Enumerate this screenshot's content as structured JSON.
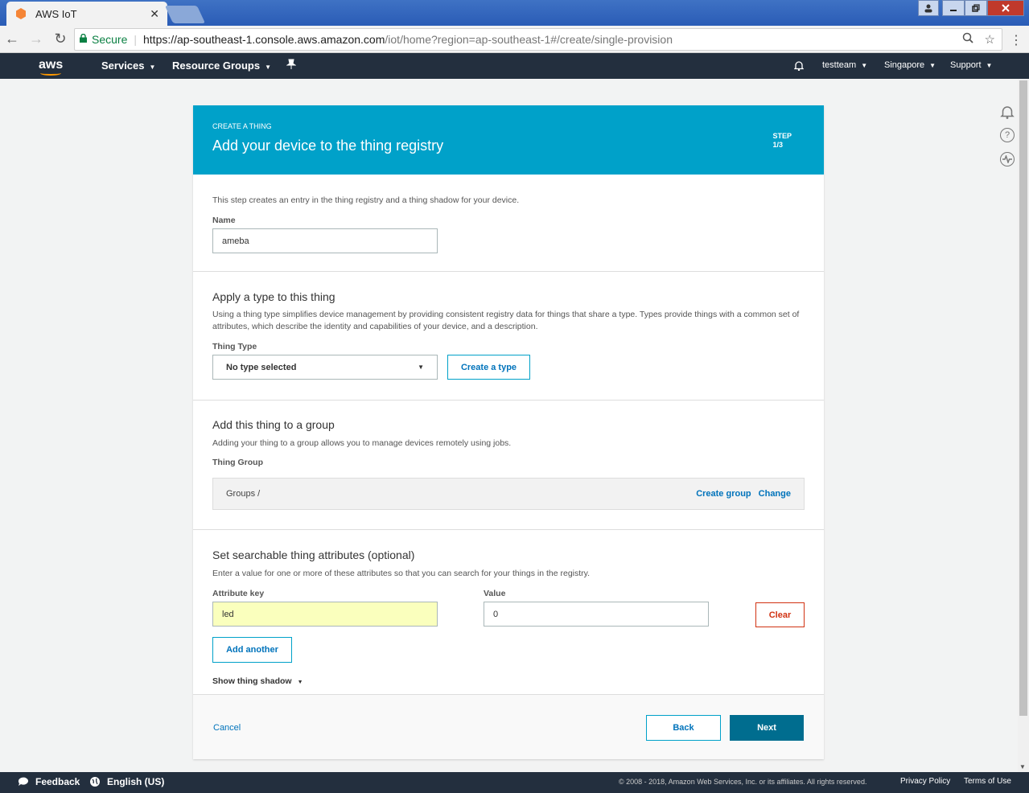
{
  "browser": {
    "tab_title": "AWS IoT",
    "tab_close": "✕",
    "secure_label": "Secure",
    "url_host": "https://ap-southeast-1.console.aws.amazon.com",
    "url_path": "/iot/home?region=ap-southeast-1#/create/single-provision"
  },
  "awsnav": {
    "logo": "aws",
    "services": "Services",
    "resource_groups": "Resource Groups",
    "account": "testteam",
    "region": "Singapore",
    "support": "Support"
  },
  "header": {
    "eyebrow": "CREATE A THING",
    "title": "Add your device to the thing registry",
    "step_label": "STEP",
    "step_value": "1/3"
  },
  "section_name": {
    "intro": "This step creates an entry in the thing registry and a thing shadow for your device.",
    "name_label": "Name",
    "name_value": "ameba"
  },
  "section_type": {
    "title": "Apply a type to this thing",
    "desc": "Using a thing type simplifies device management by providing consistent registry data for things that share a type. Types provide things with a common set of attributes, which describe the identity and capabilities of your device, and a description.",
    "type_label": "Thing Type",
    "type_value": "No type selected",
    "create_type": "Create a type"
  },
  "section_group": {
    "title": "Add this thing to a group",
    "desc": "Adding your thing to a group allows you to manage devices remotely using jobs.",
    "group_label": "Thing Group",
    "groups_path": "Groups /",
    "create_group": "Create group",
    "change": "Change"
  },
  "section_attrs": {
    "title": "Set searchable thing attributes (optional)",
    "desc": "Enter a value for one or more of these attributes so that you can search for your things in the registry.",
    "key_label": "Attribute key",
    "value_label": "Value",
    "key_value": "led",
    "value_value": "0",
    "clear": "Clear",
    "add_another": "Add another",
    "show_shadow": "Show thing shadow"
  },
  "footer_actions": {
    "cancel": "Cancel",
    "back": "Back",
    "next": "Next"
  },
  "bottombar": {
    "feedback": "Feedback",
    "language": "English (US)",
    "copyright": "© 2008 - 2018, Amazon Web Services, Inc. or its affiliates. All rights reserved.",
    "privacy": "Privacy Policy",
    "terms": "Terms of Use"
  },
  "colors": {
    "header_blue": "#00a1c9",
    "nav_dark": "#232f3e",
    "primary": "#006d8f",
    "danger": "#d13212",
    "autofill": "#faffbd"
  }
}
